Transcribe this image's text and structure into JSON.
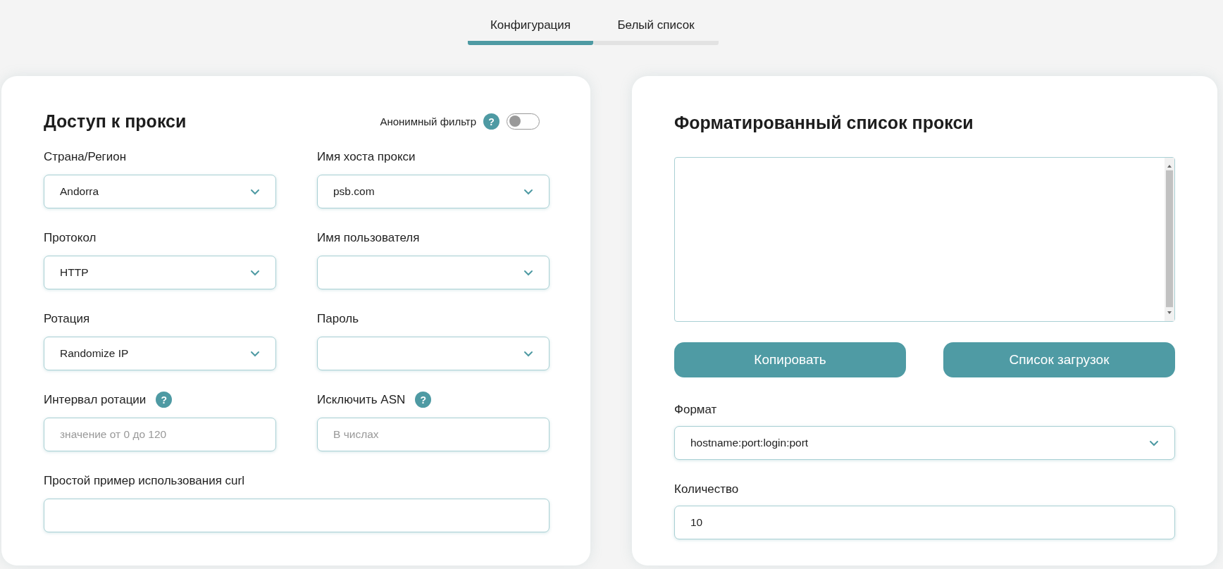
{
  "tabs": [
    {
      "label": "Конфигурация",
      "selected": true
    },
    {
      "label": "Белый список",
      "selected": false
    }
  ],
  "access": {
    "title": "Доступ к прокси",
    "anon_filter": {
      "label": "Анонимный фильтр",
      "help": "?",
      "on": false
    },
    "fields": [
      {
        "kind": "select",
        "label": "Страна/Регион",
        "value": "Andorra"
      },
      {
        "kind": "select",
        "label": "Имя хоста прокси",
        "value": "psb.com"
      },
      {
        "kind": "select",
        "label": "Протокол",
        "value": "HTTP"
      },
      {
        "kind": "select",
        "label": "Имя пользователя"
      },
      {
        "kind": "select",
        "label": "Ротация",
        "value": "Randomize IP"
      },
      {
        "kind": "select",
        "label": "Пароль"
      },
      {
        "kind": "input",
        "label": "Интервал ротации",
        "help": "?",
        "placeholder": "значение от 0 до 120"
      },
      {
        "kind": "input",
        "label": "Исключить ASN",
        "help": "?",
        "placeholder": "В числах"
      },
      {
        "kind": "wide",
        "label": "Простой пример использования curl"
      }
    ]
  },
  "list": {
    "title": "Форматированный список прокси",
    "buttons": [
      "Копировать",
      "Список загрузок"
    ],
    "fields": [
      {
        "kind": "select",
        "label": "Формат",
        "value": "hostname:port:login:port"
      },
      {
        "kind": "input",
        "label": "Количество",
        "value": "10"
      }
    ]
  }
}
